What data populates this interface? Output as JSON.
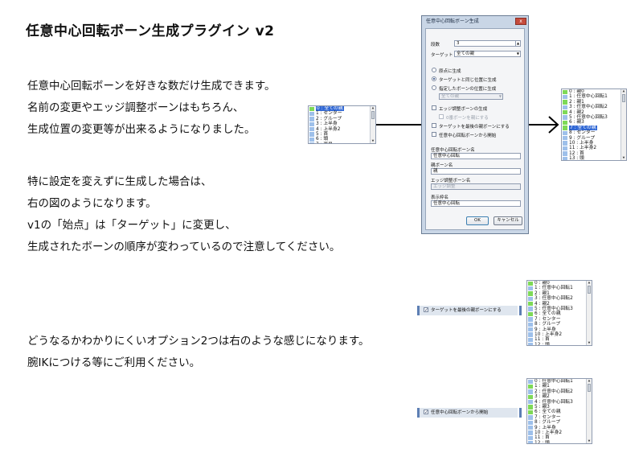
{
  "title": "任意中心回転ボーン生成プラグイン v2",
  "paragraphs": {
    "p1": [
      "任意中心回転ボーンを好きな数だけ生成できます。",
      "名前の変更やエッジ調整ボーンはもちろん、",
      "生成位置の変更等が出来るようになりました。"
    ],
    "p2": [
      "特に設定を変えずに生成した場合は、",
      "右の図のようになります。",
      "v1の「始点」は「ターゲット」に変更し、",
      "生成されたボーンの順序が変わっているので注意してください。"
    ],
    "p3": [
      "どうなるかわかりにくいオプション2つは右のような感じになります。",
      "腕IKにつける等にご利用ください。"
    ]
  },
  "dialog": {
    "title": "任意中心回転ボーン生成",
    "close": "x",
    "count_label": "段数",
    "count_value": "3",
    "target_label": "ターゲット",
    "target_value": "全ての親",
    "radio_origin": "原点に生成",
    "radio_target_pos": "ターゲットと同じ位置に生成",
    "radio_bone_pos": "指定したボーンの位置に生成",
    "bone_pos_value": "全ての親",
    "edge_bone": "エッジ調整ボーンの生成",
    "zero_bone": "0番ボーンを親にする",
    "target_last_parent": "ターゲットを最後の親ボーンにする",
    "start_from_rot": "任意中心回転ボーンから開始",
    "rot_name_label": "任意中心回転ボーン名",
    "rot_name_value": "任意中心回転",
    "parent_name_label": "親ボーン名",
    "parent_name_value": "親",
    "edge_name_label": "エッジ調整ボーン名",
    "edge_name_value": "エッジ調整",
    "display_label": "表示枠名",
    "display_value": "任意中心回転",
    "ok": "OK",
    "cancel": "キャンセル"
  },
  "lists": {
    "before": [
      "0 : 全ての親",
      "1 : センター",
      "2 : グループ",
      "3 : 上半身",
      "4 : 上半身2",
      "5 : 首",
      "6 : 頭",
      "7 : 両目"
    ],
    "after": [
      "0 : 親0",
      "1 : 任意中心回転1",
      "2 : 親1",
      "3 : 任意中心回転2",
      "4 : 親2",
      "5 : 任意中心回転3",
      "6 : 親3",
      "7 : 全ての親",
      "8 : センター",
      "9 : グループ",
      "10 : 上半身",
      "11 : 上半身2",
      "12 : 首",
      "13 : 頭",
      "14 : 両目"
    ],
    "opt1": [
      "0 : 親0",
      "1 : 任意中心回転1",
      "2 : 親1",
      "3 : 任意中心回転2",
      "4 : 親2",
      "5 : 任意中心回転3",
      "6 : 全ての親",
      "7 : センター",
      "8 : グループ",
      "9 : 上半身",
      "10 : 上半身2",
      "11 : 首",
      "12 : 頭",
      "13 : 両目"
    ],
    "opt2": [
      "0 : 任意中心回転1",
      "1 : 親1",
      "2 : 任意中心回転2",
      "3 : 親2",
      "4 : 任意中心回転3",
      "5 : 親3",
      "6 : 全ての親",
      "7 : センター",
      "8 : グループ",
      "9 : 上半身",
      "10 : 上半身2",
      "11 : 首",
      "12 : 頭",
      "13 : 両目"
    ]
  },
  "options": {
    "opt1_label": "ターゲットを最後の親ボーンにする",
    "opt2_label": "任意中心回転ボーンから開始"
  },
  "colors": {
    "selection": "#3168d5",
    "mark_green": "#7ed957",
    "mark_blue": "#9ec0ea"
  },
  "icons": {
    "arrow": "right-arrow-icon",
    "check": "checkbox-icon",
    "radio": "radio-button-icon"
  }
}
